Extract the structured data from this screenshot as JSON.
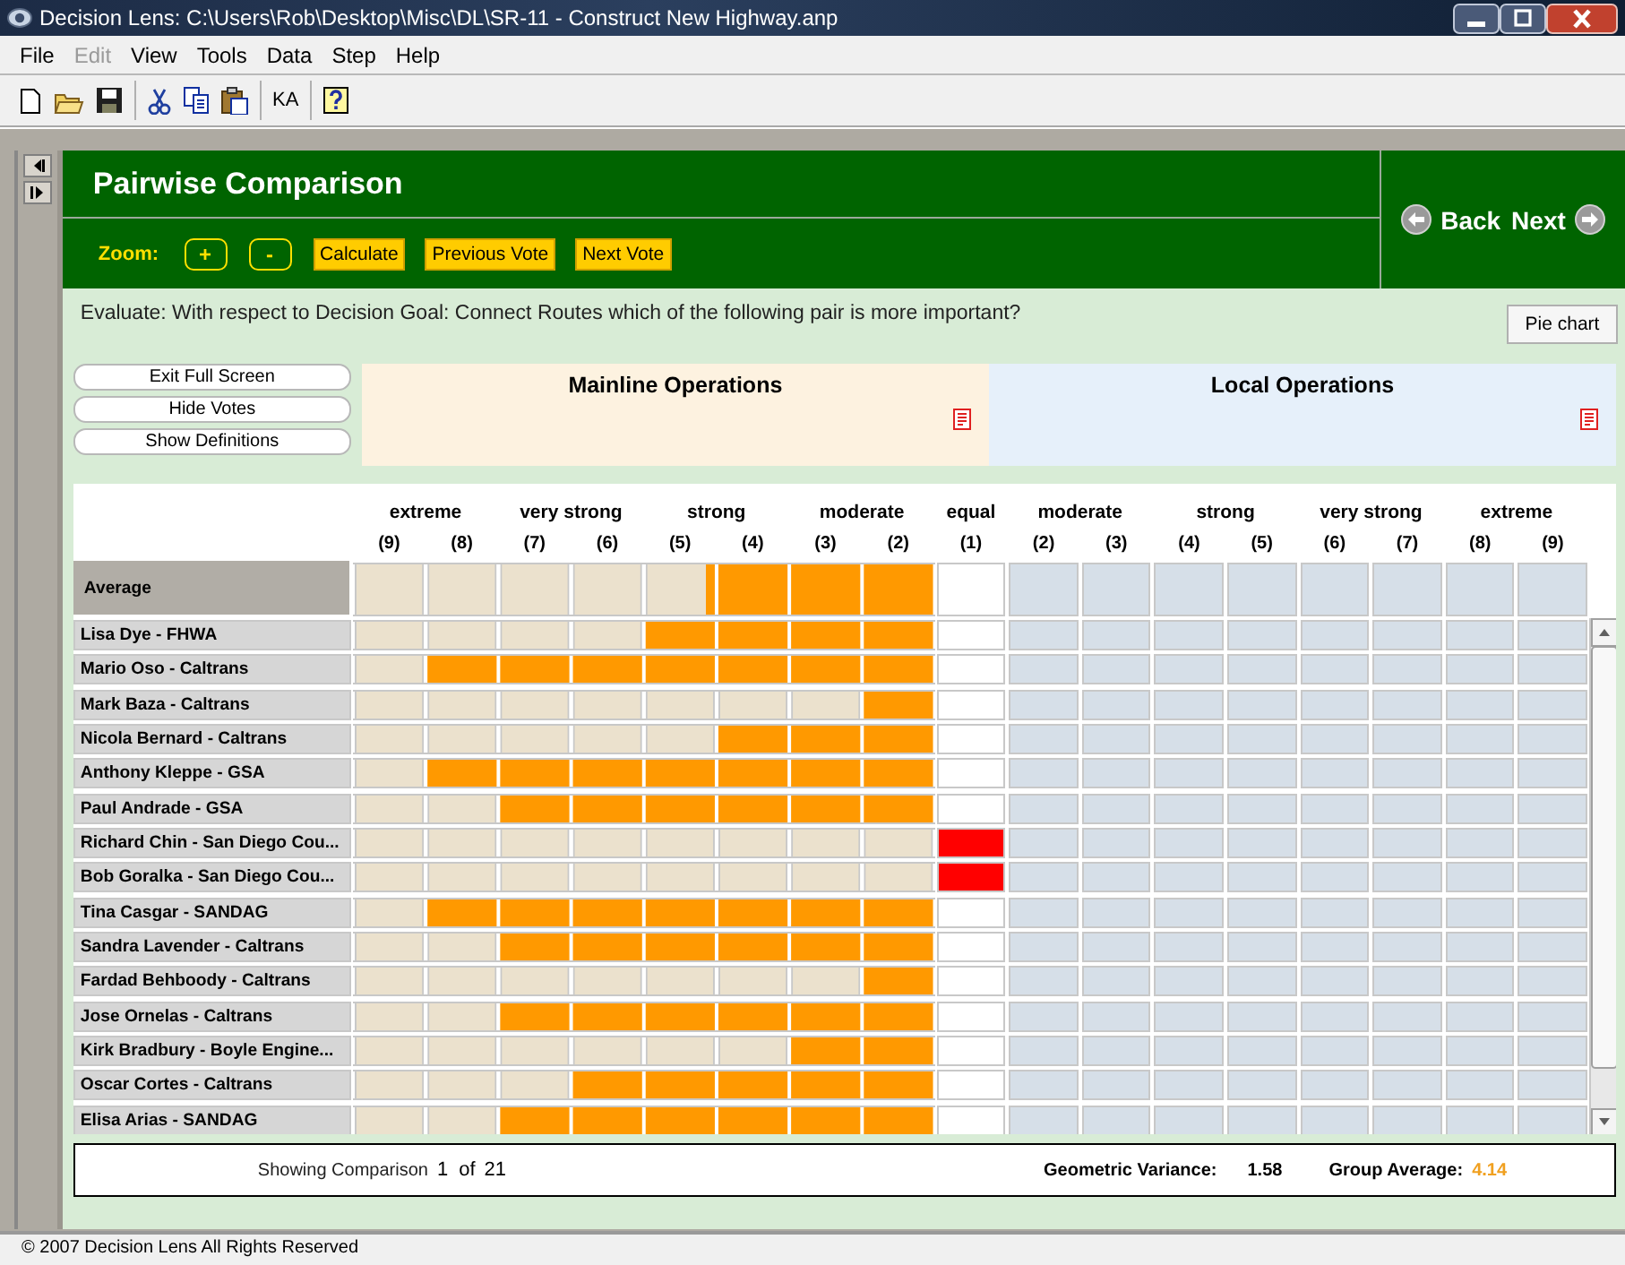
{
  "window": {
    "title": "Decision Lens: C:\\Users\\Rob\\Desktop\\Misc\\DL\\SR-11 - Construct New Highway.anp"
  },
  "menu": [
    {
      "label": "File",
      "disabled": false
    },
    {
      "label": "Edit",
      "disabled": true
    },
    {
      "label": "View",
      "disabled": false
    },
    {
      "label": "Tools",
      "disabled": false
    },
    {
      "label": "Data",
      "disabled": false
    },
    {
      "label": "Step",
      "disabled": false
    },
    {
      "label": "Help",
      "disabled": false
    }
  ],
  "toolbar": [
    {
      "kind": "new"
    },
    {
      "kind": "open"
    },
    {
      "kind": "save"
    },
    {
      "kind": "separator"
    },
    {
      "kind": "cut"
    },
    {
      "kind": "copy"
    },
    {
      "kind": "paste"
    },
    {
      "kind": "separator"
    },
    {
      "kind": "text",
      "label": "KA"
    },
    {
      "kind": "separator"
    },
    {
      "kind": "help"
    }
  ],
  "header": {
    "title": "Pairwise Comparison",
    "zoom_label": "Zoom:",
    "zoom_buttons": [
      "+",
      "-"
    ],
    "actions": [
      "Calculate",
      "Previous Vote",
      "Next Vote"
    ],
    "back": "Back",
    "next": "Next"
  },
  "question": "Evaluate: With respect to Decision Goal: Connect Routes which of the following pair is more important?",
  "pie_chart_button": "Pie chart",
  "side_buttons": [
    "Exit Full Screen",
    "Hide Votes",
    "Show Definitions"
  ],
  "pair": [
    {
      "name": "Mainline Operations"
    },
    {
      "name": "Local Operations"
    }
  ],
  "grid": {
    "scale_labels": [
      "extreme",
      "very strong",
      "strong",
      "moderate",
      "equal",
      "moderate",
      "strong",
      "very strong",
      "extreme"
    ],
    "columns": [
      "(9)",
      "(8)",
      "(7)",
      "(6)",
      "(5)",
      "(4)",
      "(3)",
      "(2)",
      "(1)",
      "(2)",
      "(3)",
      "(4)",
      "(5)",
      "(6)",
      "(7)",
      "(8)",
      "(9)"
    ],
    "average": {
      "name": "Average",
      "level": 0.3925,
      "equal": false
    },
    "rows": [
      {
        "name": "Lisa Dye - FHWA",
        "level": 0.5,
        "equal": false
      },
      {
        "name": "Mario Oso - Caltrans",
        "level": 0.875,
        "equal": false
      },
      {
        "name": "Mark Baza - Caltrans",
        "level": 0.125,
        "equal": false
      },
      {
        "name": "Nicola Bernard - Caltrans",
        "level": 0.375,
        "equal": false
      },
      {
        "name": "Anthony Kleppe - GSA",
        "level": 0.875,
        "equal": false
      },
      {
        "name": "Paul Andrade - GSA",
        "level": 0.75,
        "equal": false
      },
      {
        "name": "Richard Chin - San Diego Cou...",
        "equal": true
      },
      {
        "name": "Bob Goralka - San Diego Cou...",
        "equal": true
      },
      {
        "name": "Tina Casgar - SANDAG",
        "level": 0.875,
        "equal": false
      },
      {
        "name": "Sandra Lavender - Caltrans",
        "level": 0.75,
        "equal": false
      },
      {
        "name": "Fardad Behboody - Caltrans",
        "level": 0.125,
        "equal": false
      },
      {
        "name": "Jose Ornelas - Caltrans",
        "level": 0.75,
        "equal": false
      },
      {
        "name": "Kirk Bradbury - Boyle Engine...",
        "level": 0.25,
        "equal": false
      },
      {
        "name": "Oscar Cortes - Caltrans",
        "level": 0.625,
        "equal": false
      },
      {
        "name": "Elisa Arias - SANDAG",
        "level": 0.75,
        "equal": false
      }
    ]
  },
  "footer": {
    "showing_label": "Showing Comparison",
    "current": "1",
    "of_label": "of",
    "total": "21",
    "variance_label": "Geometric Variance:",
    "variance": "1.58",
    "group_average_label": "Group Average:",
    "group_average": "4.14"
  },
  "status": "© 2007 Decision Lens All Rights Reserved"
}
